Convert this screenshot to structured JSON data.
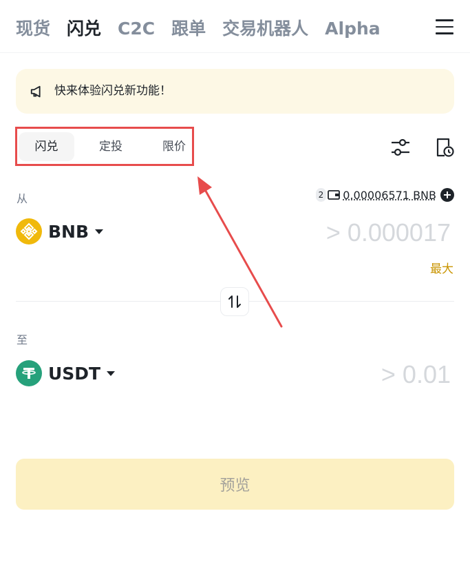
{
  "nav": {
    "tabs": [
      {
        "label": "现货"
      },
      {
        "label": "闪兑"
      },
      {
        "label": "C2C"
      },
      {
        "label": "跟单"
      },
      {
        "label": "交易机器人"
      },
      {
        "label": "Alpha"
      }
    ],
    "active": "闪兑"
  },
  "banner": {
    "text": "快来体验闪兑新功能！"
  },
  "modes": {
    "tabs": [
      {
        "label": "闪兑"
      },
      {
        "label": "定投"
      },
      {
        "label": "限价"
      }
    ],
    "active": "闪兑"
  },
  "from": {
    "label": "从",
    "badge": "2",
    "balance": "0.00006571 BNB",
    "token": "BNB",
    "amount_placeholder": "> 0.000017",
    "max_label": "最大"
  },
  "to": {
    "label": "至",
    "token": "USDT",
    "amount_placeholder": "> 0.01"
  },
  "preview_label": "预览",
  "colors": {
    "bnb": "#f0b90b",
    "usdt": "#26a17b",
    "accent": "#c99400",
    "highlight_box": "#e74c4c"
  }
}
